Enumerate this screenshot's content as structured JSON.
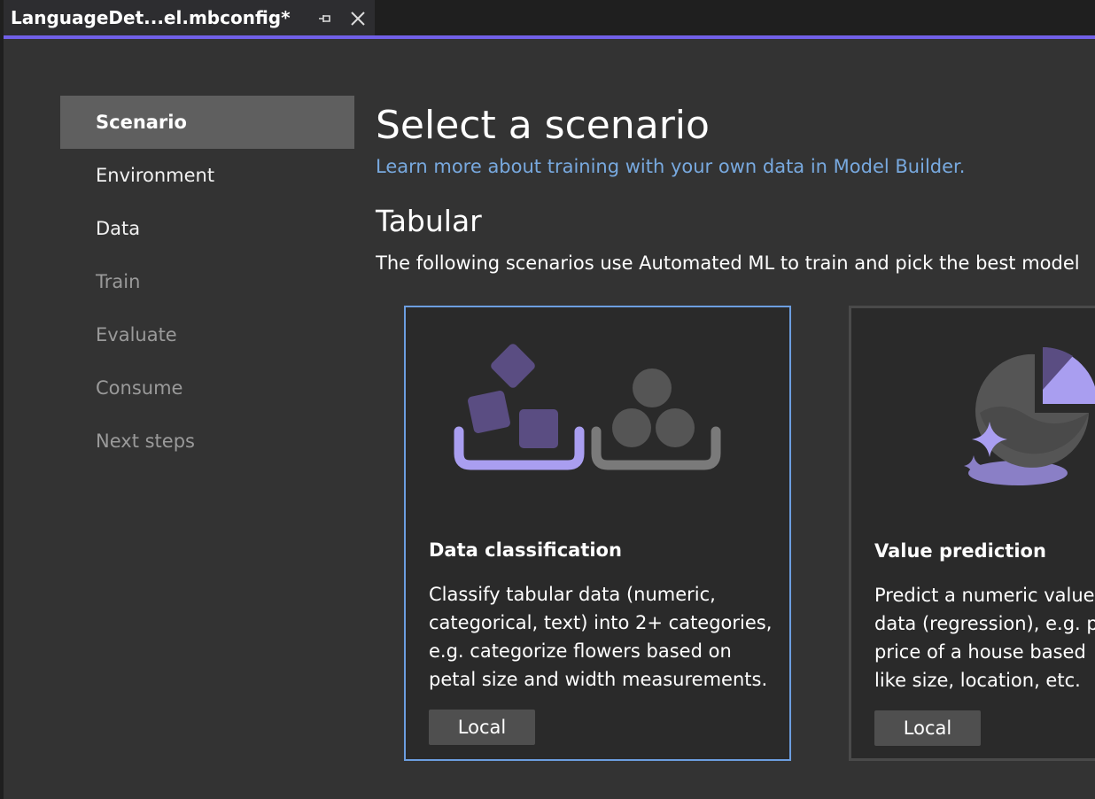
{
  "tab": {
    "title": "LanguageDet...el.mbconfig*",
    "pin_icon": "pin-icon",
    "close_icon": "close-icon"
  },
  "nav": {
    "items": [
      {
        "label": "Scenario",
        "state": "active"
      },
      {
        "label": "Environment",
        "state": "enabled"
      },
      {
        "label": "Data",
        "state": "enabled"
      },
      {
        "label": "Train",
        "state": "disabled"
      },
      {
        "label": "Evaluate",
        "state": "disabled"
      },
      {
        "label": "Consume",
        "state": "disabled"
      },
      {
        "label": "Next steps",
        "state": "disabled"
      }
    ]
  },
  "main": {
    "title": "Select a scenario",
    "learn_link": "Learn more about training with your own data in Model Builder.",
    "section": {
      "title": "Tabular",
      "description": "The following scenarios use Automated ML to train and pick the best model"
    },
    "cards": [
      {
        "title": "Data classification",
        "description_lines": [
          "Classify tabular data (numeric,",
          "categorical, text) into 2+ categories,",
          "e.g. categorize flowers based on",
          "petal size and width measurements."
        ],
        "button": "Local",
        "icon": "data-classification-illustration"
      },
      {
        "title": "Value prediction",
        "description_lines": [
          "Predict a numeric value",
          "data (regression), e.g. pr",
          "price of a house based",
          "like size, location, etc."
        ],
        "button": "Local",
        "icon": "value-prediction-illustration"
      }
    ]
  },
  "colors": {
    "accent": "#7160e8",
    "link": "#78a9df",
    "selected_card_border": "#6c9ee0",
    "illustration_purple": "#a99ef0",
    "illustration_dark_purple": "#5a4d82"
  }
}
